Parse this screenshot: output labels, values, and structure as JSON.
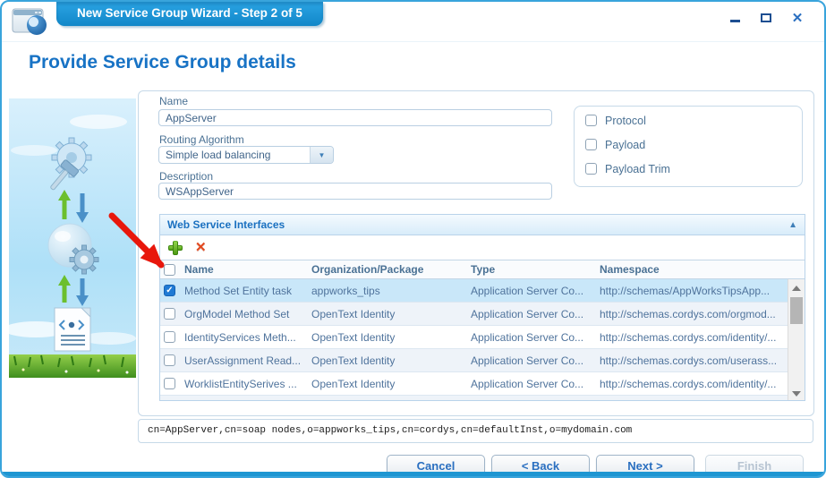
{
  "window": {
    "title": "New Service Group Wizard - Step 2 of 5"
  },
  "page": {
    "heading": "Provide Service Group details"
  },
  "form": {
    "name": {
      "label": "Name",
      "value": "AppServer"
    },
    "routing": {
      "label": "Routing Algorithm",
      "value": "Simple load balancing"
    },
    "description": {
      "label": "Description",
      "value": "WSAppServer"
    },
    "options": [
      {
        "label": "Protocol",
        "checked": false
      },
      {
        "label": "Payload",
        "checked": false
      },
      {
        "label": "Payload Trim",
        "checked": false
      }
    ]
  },
  "interfaces": {
    "title": "Web Service Interfaces",
    "columns": [
      "Name",
      "Organization/Package",
      "Type",
      "Namespace"
    ],
    "rows": [
      {
        "checked": true,
        "selected": true,
        "name": "Method Set Entity task",
        "org": "appworks_tips",
        "type": "Application Server Co...",
        "namespace": "http://schemas/AppWorksTipsApp..."
      },
      {
        "checked": false,
        "selected": false,
        "name": "OrgModel Method Set",
        "org": "OpenText Identity",
        "type": "Application Server Co...",
        "namespace": "http://schemas.cordys.com/orgmod..."
      },
      {
        "checked": false,
        "selected": false,
        "name": "IdentityServices Meth...",
        "org": "OpenText Identity",
        "type": "Application Server Co...",
        "namespace": "http://schemas.cordys.com/identity/..."
      },
      {
        "checked": false,
        "selected": false,
        "name": "UserAssignment Read...",
        "org": "OpenText Identity",
        "type": "Application Server Co...",
        "namespace": "http://schemas.cordys.com/userass..."
      },
      {
        "checked": false,
        "selected": false,
        "name": "WorklistEntitySerives ...",
        "org": "OpenText Identity",
        "type": "Application Server Co...",
        "namespace": "http://schemas.cordys.com/identity/..."
      }
    ]
  },
  "statusbar": {
    "text": "cn=AppServer,cn=soap nodes,o=appworks_tips,cn=cordys,cn=defaultInst,o=mydomain.com"
  },
  "buttons": {
    "cancel": "Cancel",
    "back": "< Back",
    "next": "Next >",
    "finish": "Finish"
  },
  "icons": {
    "close": "✕",
    "collapse": "▲",
    "dropdown": "▼",
    "check": "✓",
    "remove": "✕"
  },
  "colors": {
    "accent_blue": "#1e96d2",
    "heading_blue": "#1873c5",
    "selected_row": "#c9e7f9",
    "add_green": "#58a718",
    "remove_red": "#e2491f",
    "annotation_red": "#e8170c"
  }
}
